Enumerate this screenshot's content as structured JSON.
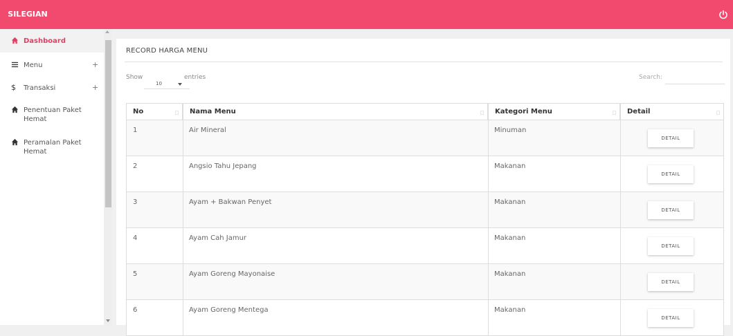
{
  "app": {
    "brand": "SILEGIAN",
    "accent": "#f2496e"
  },
  "sidebar": {
    "items": [
      {
        "label": "Dashboard",
        "icon": "home-icon",
        "active": true
      },
      {
        "label": "Menu",
        "icon": "menu-icon",
        "expandable": "+"
      },
      {
        "label": "Transaksi",
        "icon": "dollar-icon",
        "expandable": "+"
      },
      {
        "label": "Penentuan Paket Hemat",
        "icon": "home-icon"
      },
      {
        "label": "Peramalan Paket Hemat",
        "icon": "home-icon"
      }
    ]
  },
  "card": {
    "title": "RECORD HARGA MENU"
  },
  "controls": {
    "show_label": "Show",
    "page_length": "10",
    "entries_label": "entries",
    "search_label": "Search:",
    "search_value": ""
  },
  "table": {
    "headers": [
      "No",
      "Nama Menu",
      "Kategori Menu",
      "Detail"
    ],
    "button_label": "DETAIL",
    "rows": [
      {
        "no": "1",
        "nama": "Air Mineral",
        "kategori": "Minuman"
      },
      {
        "no": "2",
        "nama": "Angsio Tahu Jepang",
        "kategori": "Makanan"
      },
      {
        "no": "3",
        "nama": "Ayam + Bakwan Penyet",
        "kategori": "Makanan"
      },
      {
        "no": "4",
        "nama": "Ayam Cah Jamur",
        "kategori": "Makanan"
      },
      {
        "no": "5",
        "nama": "Ayam Goreng Mayonaise",
        "kategori": "Makanan"
      },
      {
        "no": "6",
        "nama": "Ayam Goreng Mentega",
        "kategori": "Makanan"
      }
    ]
  }
}
